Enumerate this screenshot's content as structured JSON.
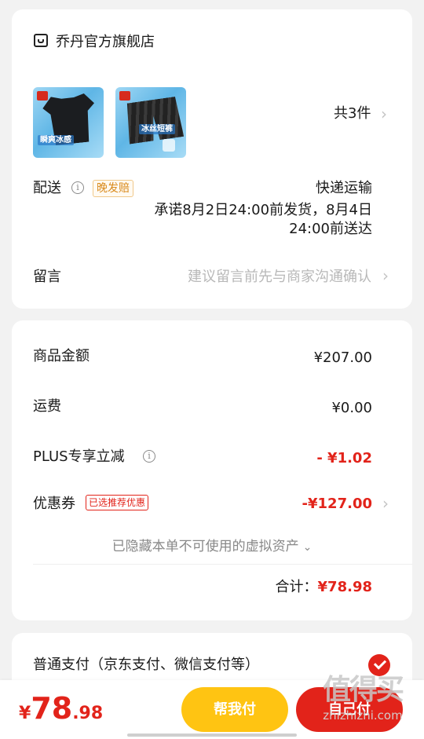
{
  "store": {
    "name": "乔丹官方旗舰店",
    "icon": "store-icon",
    "total_items": "共3件",
    "products": [
      {
        "icon": "product-tshirt-image",
        "tag": "瞬爽冰感"
      },
      {
        "icon": "product-shorts-image",
        "tag": "冰丝短裤"
      }
    ]
  },
  "delivery": {
    "label": "配送",
    "badge": "晚发赔",
    "method": "快递运输",
    "promise_line1": "承诺8月2日24:00前发货，8月4日",
    "promise_line2": "24:00前送达"
  },
  "message": {
    "label": "留言",
    "placeholder": "建议留言前先与商家沟通确认"
  },
  "pricing": {
    "goods_label": "商品金额",
    "goods_value": "¥207.00",
    "shipping_label": "运费",
    "shipping_value": "¥0.00",
    "plus_label": "PLUS专享立减",
    "plus_value": "- ¥1.02",
    "coupon_label": "优惠券",
    "coupon_badge": "已选推荐优惠",
    "coupon_value": "-¥127.00",
    "hidden_assets": "已隐藏本单不可使用的虚拟资产",
    "total_label": "合计：",
    "total_value": "¥78.98"
  },
  "payment": {
    "method_label": "普通支付（京东支付、微信支付等）",
    "selected": true
  },
  "bottom": {
    "currency": "¥",
    "price_int": "78",
    "price_dec": ".98",
    "help_pay_label": "帮我付",
    "pay_label": "自己付"
  },
  "watermark": {
    "main": "值得买",
    "sub": "zhizhizhi.com"
  },
  "colors": {
    "accent_red": "#e2231a",
    "accent_yellow": "#ffc412",
    "badge_orange": "#d98a1c"
  }
}
